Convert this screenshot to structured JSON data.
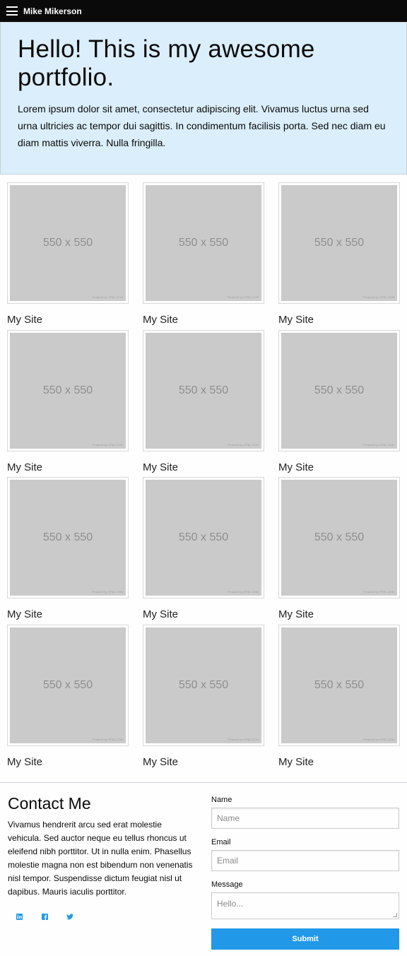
{
  "header": {
    "title": "Mike Mikerson",
    "menu_icon": "hamburger-icon"
  },
  "hero": {
    "title": "Hello! This is my awesome portfolio.",
    "body": "Lorem ipsum dolor sit amet, consectetur adipiscing elit. Vivamus luctus urna sed urna ultricies ac tempor dui sagittis. In condimentum facilisis porta. Sed nec diam eu diam mattis viverra. Nulla fringilla."
  },
  "portfolio": {
    "items": [
      {
        "image_text": "550 x 550",
        "caption": "My Site"
      },
      {
        "image_text": "550 x 550",
        "caption": "My Site"
      },
      {
        "image_text": "550 x 550",
        "caption": "My Site"
      },
      {
        "image_text": "550 x 550",
        "caption": "My Site"
      },
      {
        "image_text": "550 x 550",
        "caption": "My Site"
      },
      {
        "image_text": "550 x 550",
        "caption": "My Site"
      },
      {
        "image_text": "550 x 550",
        "caption": "My Site"
      },
      {
        "image_text": "550 x 550",
        "caption": "My Site"
      },
      {
        "image_text": "550 x 550",
        "caption": "My Site"
      },
      {
        "image_text": "550 x 550",
        "caption": "My Site"
      },
      {
        "image_text": "550 x 550",
        "caption": "My Site"
      },
      {
        "image_text": "550 x 550",
        "caption": "My Site"
      }
    ],
    "powered_text": "Powered by HTML.COM"
  },
  "contact": {
    "title": "Contact Me",
    "body": "Vivamus hendrerit arcu sed erat molestie vehicula. Sed auctor neque eu tellus rhoncus ut eleifend nibh porttitor. Ut in nulla enim. Phasellus molestie magna non est bibendum non venenatis nisl tempor. Suspendisse dictum feugiat nisl ut dapibus. Mauris iaculis porttitor.",
    "socials": [
      {
        "icon": "linkedin-icon",
        "glyph": "in"
      },
      {
        "icon": "facebook-icon",
        "glyph": "f"
      },
      {
        "icon": "twitter-icon",
        "glyph": "t"
      }
    ]
  },
  "form": {
    "name_label": "Name",
    "name_placeholder": "Name",
    "email_label": "Email",
    "email_placeholder": "Email",
    "message_label": "Message",
    "message_placeholder": "Hello...",
    "submit_label": "Submit"
  },
  "colors": {
    "topbar": "#0a0a0a",
    "hero_bg": "#dbeefb",
    "placeholder_gray": "#cacaca",
    "primary": "#2199e8"
  }
}
